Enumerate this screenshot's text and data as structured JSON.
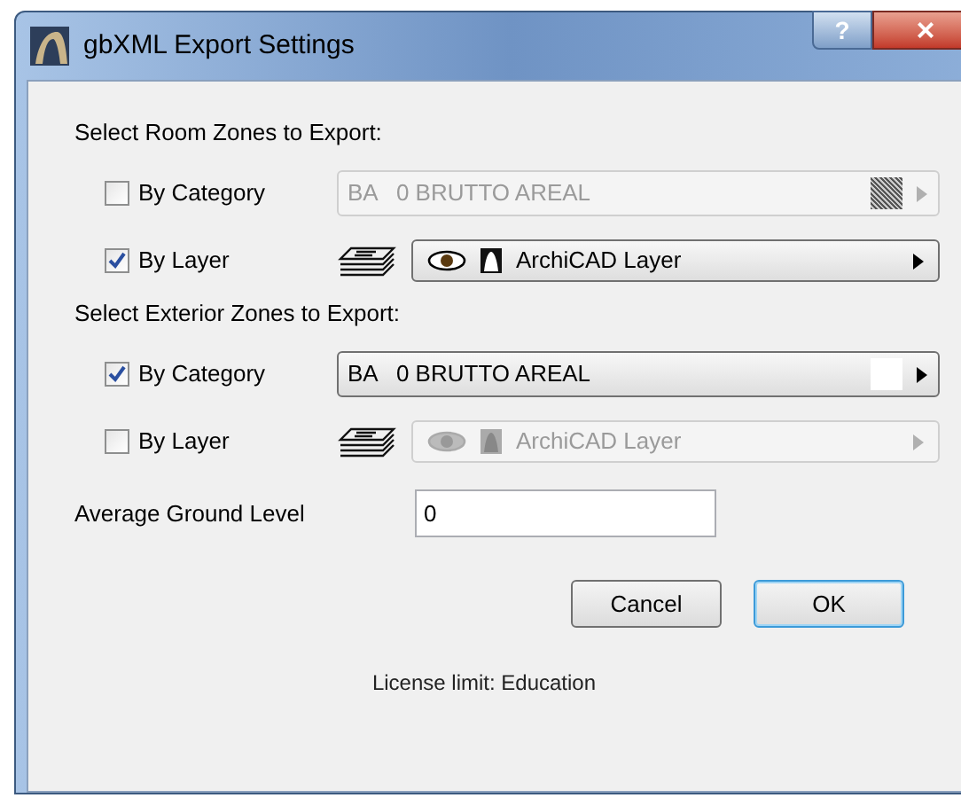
{
  "window": {
    "title": "gbXML Export Settings",
    "help": "?",
    "close": "×"
  },
  "sections": [
    {
      "heading": "Select Room Zones to Export:",
      "rows": [
        {
          "kind": "category",
          "label": "By Category",
          "checked": false,
          "value": "BA   0 BRUTTO AREAL",
          "disabled": true
        },
        {
          "kind": "layer",
          "label": "By Layer",
          "checked": true,
          "value": "ArchiCAD Layer",
          "disabled": false
        }
      ]
    },
    {
      "heading": "Select Exterior Zones to Export:",
      "rows": [
        {
          "kind": "category",
          "label": "By Category",
          "checked": true,
          "value": "BA   0 BRUTTO AREAL",
          "disabled": false
        },
        {
          "kind": "layer",
          "label": "By Layer",
          "checked": false,
          "value": "ArchiCAD Layer",
          "disabled": true
        }
      ]
    }
  ],
  "ground_level": {
    "label": "Average Ground Level",
    "value": "0"
  },
  "buttons": [
    {
      "label": "Cancel",
      "default": false
    },
    {
      "label": "OK",
      "default": true
    }
  ],
  "license": "License limit: Education"
}
